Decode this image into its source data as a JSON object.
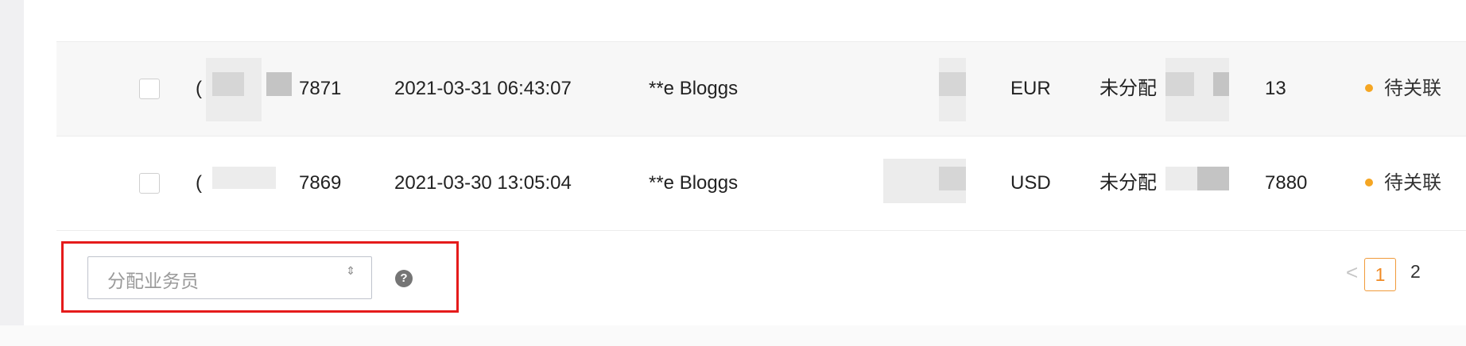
{
  "table": {
    "rows": [
      {
        "order_prefix": "(",
        "order_suffix": "7871",
        "date": "2021-03-31 06:43:07",
        "customer": "**e Bloggs",
        "currency": "EUR",
        "assignee": "未分配",
        "amount_suffix": "13",
        "status": "待关联"
      },
      {
        "order_prefix": "(",
        "order_suffix": "7869",
        "date": "2021-03-30 13:05:04",
        "customer": "**e Bloggs",
        "currency": "USD",
        "assignee": "未分配",
        "amount_suffix": "7880",
        "status": "待关联"
      }
    ]
  },
  "footer": {
    "assign_select_placeholder": "分配业务员",
    "select_arrows": "⇕",
    "help_icon_glyph": "?",
    "pagination": {
      "prev": "<",
      "current": "1",
      "next_page": "2"
    }
  },
  "colors": {
    "accent": "#f08a24",
    "status_dot": "#f5a623",
    "highlight_border": "#e51b1b"
  },
  "icons": {
    "help": "question-circle-icon",
    "select_arrows": "sort-arrows-icon",
    "prev": "chevron-left-icon"
  }
}
